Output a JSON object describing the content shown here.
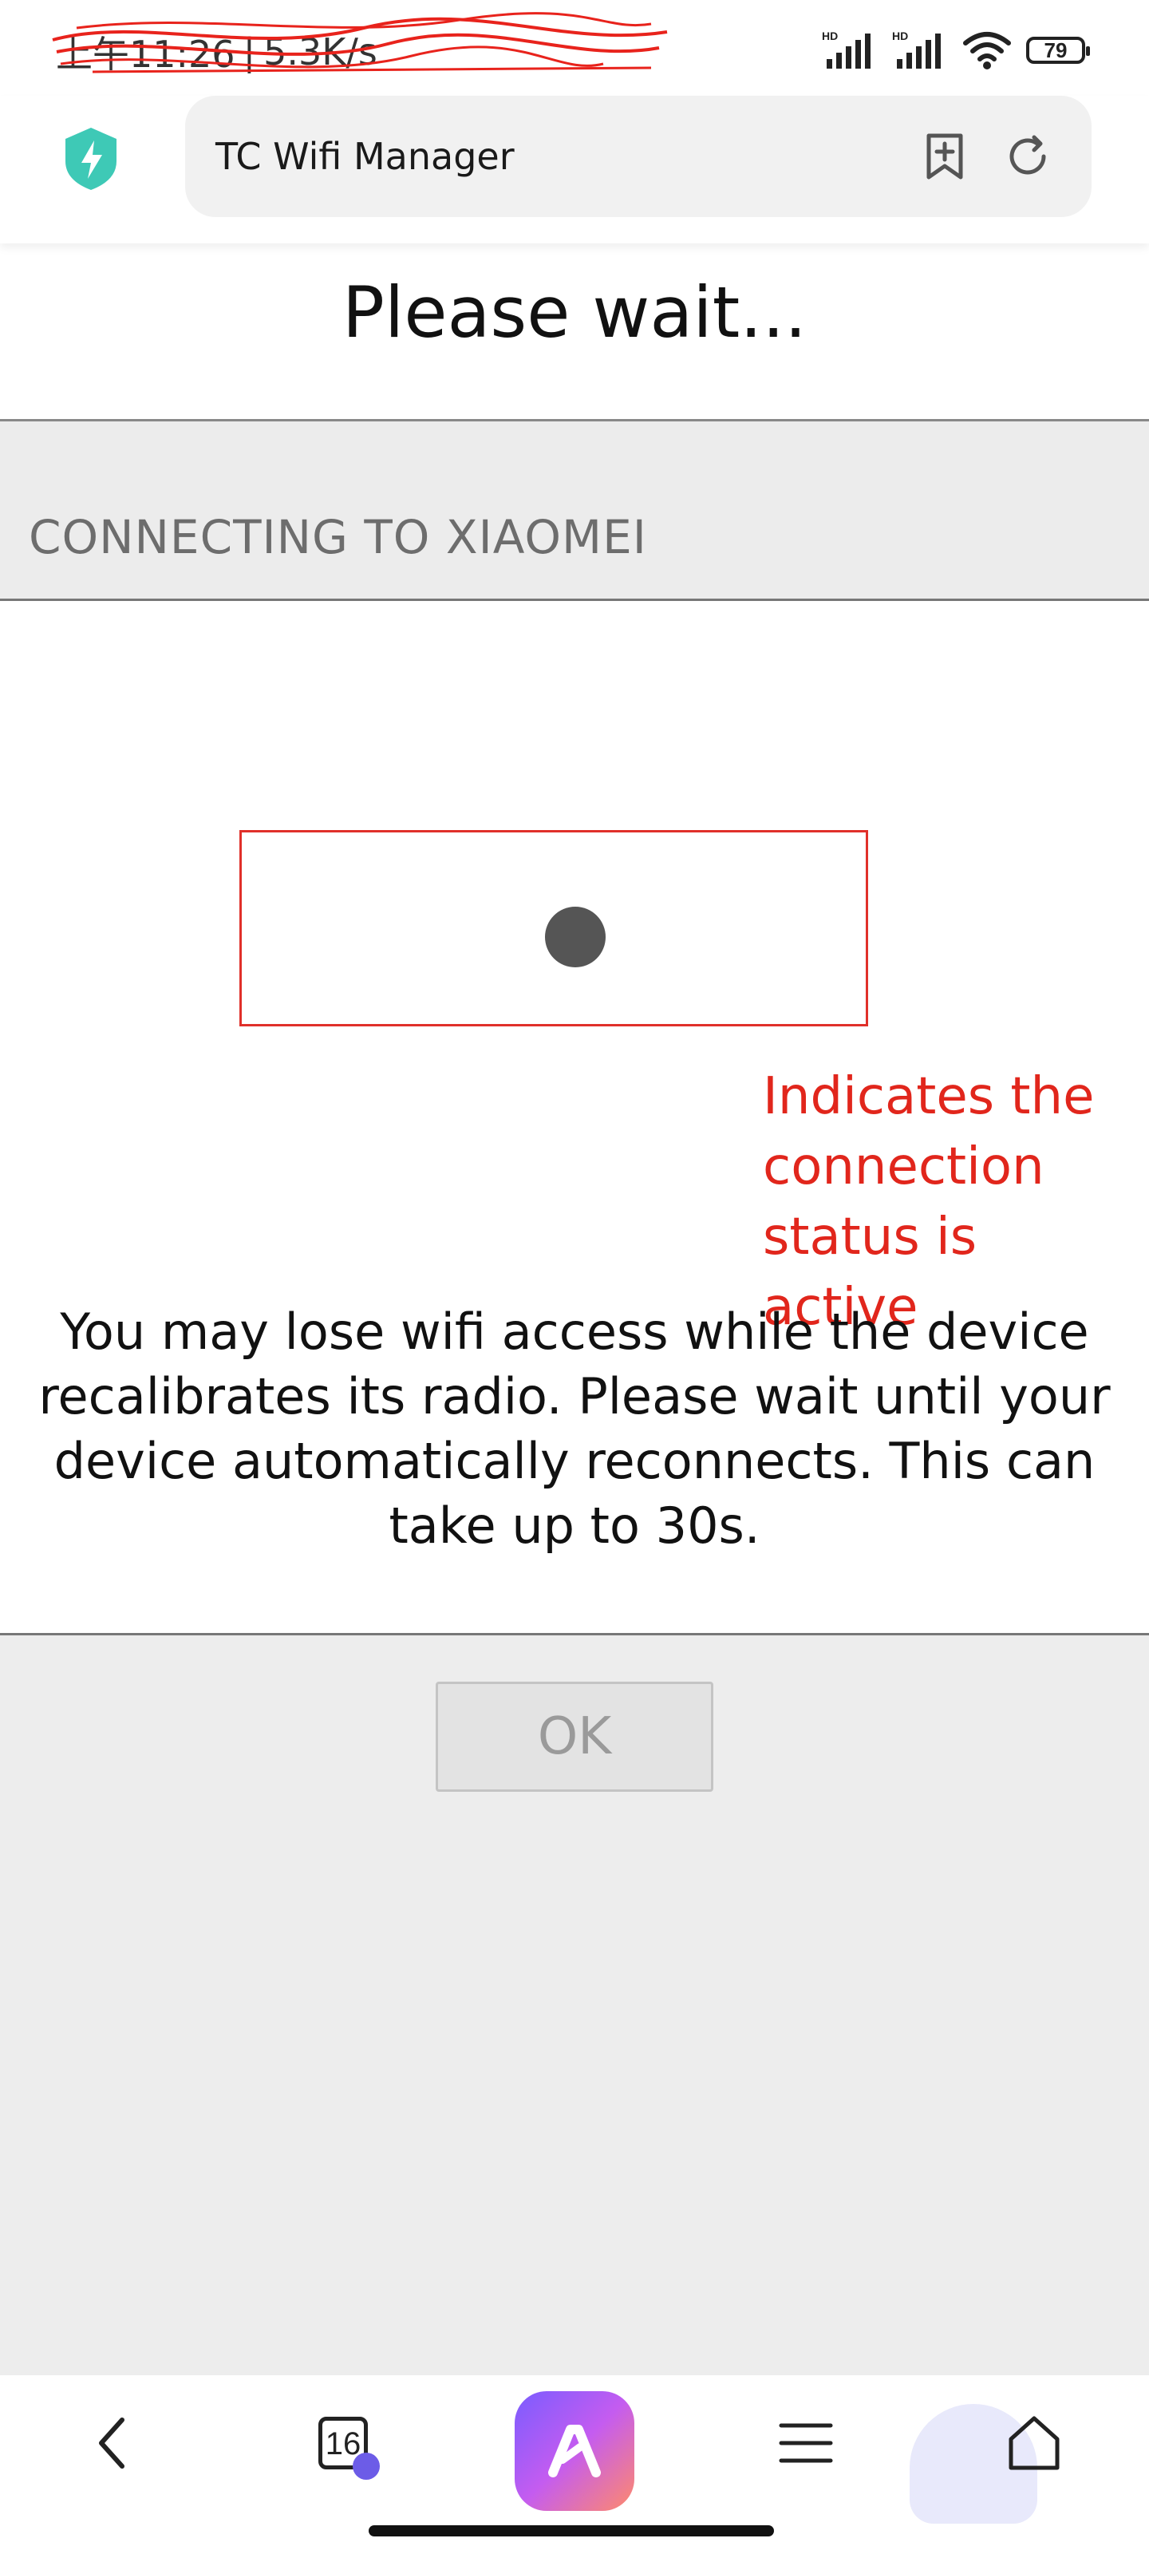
{
  "status_bar": {
    "time": "上午11:26",
    "speed": "5.3K/s",
    "signal_left_label": "HD",
    "signal_right_label": "HD",
    "battery": "79",
    "icons": [
      "alarm-icon",
      "lock-icon",
      "signal-icon",
      "wifi-icon",
      "battery-icon"
    ]
  },
  "browser": {
    "url_text": "TC Wifi Manager",
    "icons": [
      "shield-bolt-icon",
      "bookmark-add-icon",
      "reload-icon"
    ],
    "accent_color": "#3ec9b6"
  },
  "page": {
    "title": "Please wait...",
    "connecting_label": "CONNECTING TO XIAOMEI",
    "annotation": "Indicates the connection status is active",
    "annotation_color": "#e1261c",
    "message": "You may lose wifi access while the device recalibrates its radio. Please wait until your device automatically reconnects. This can take up to 30s.",
    "ok_label": "OK"
  },
  "bottom_nav": {
    "tab_count": "16",
    "icons": [
      "back-icon",
      "tabs-icon",
      "ai-assistant-icon",
      "menu-icon",
      "home-icon"
    ]
  }
}
